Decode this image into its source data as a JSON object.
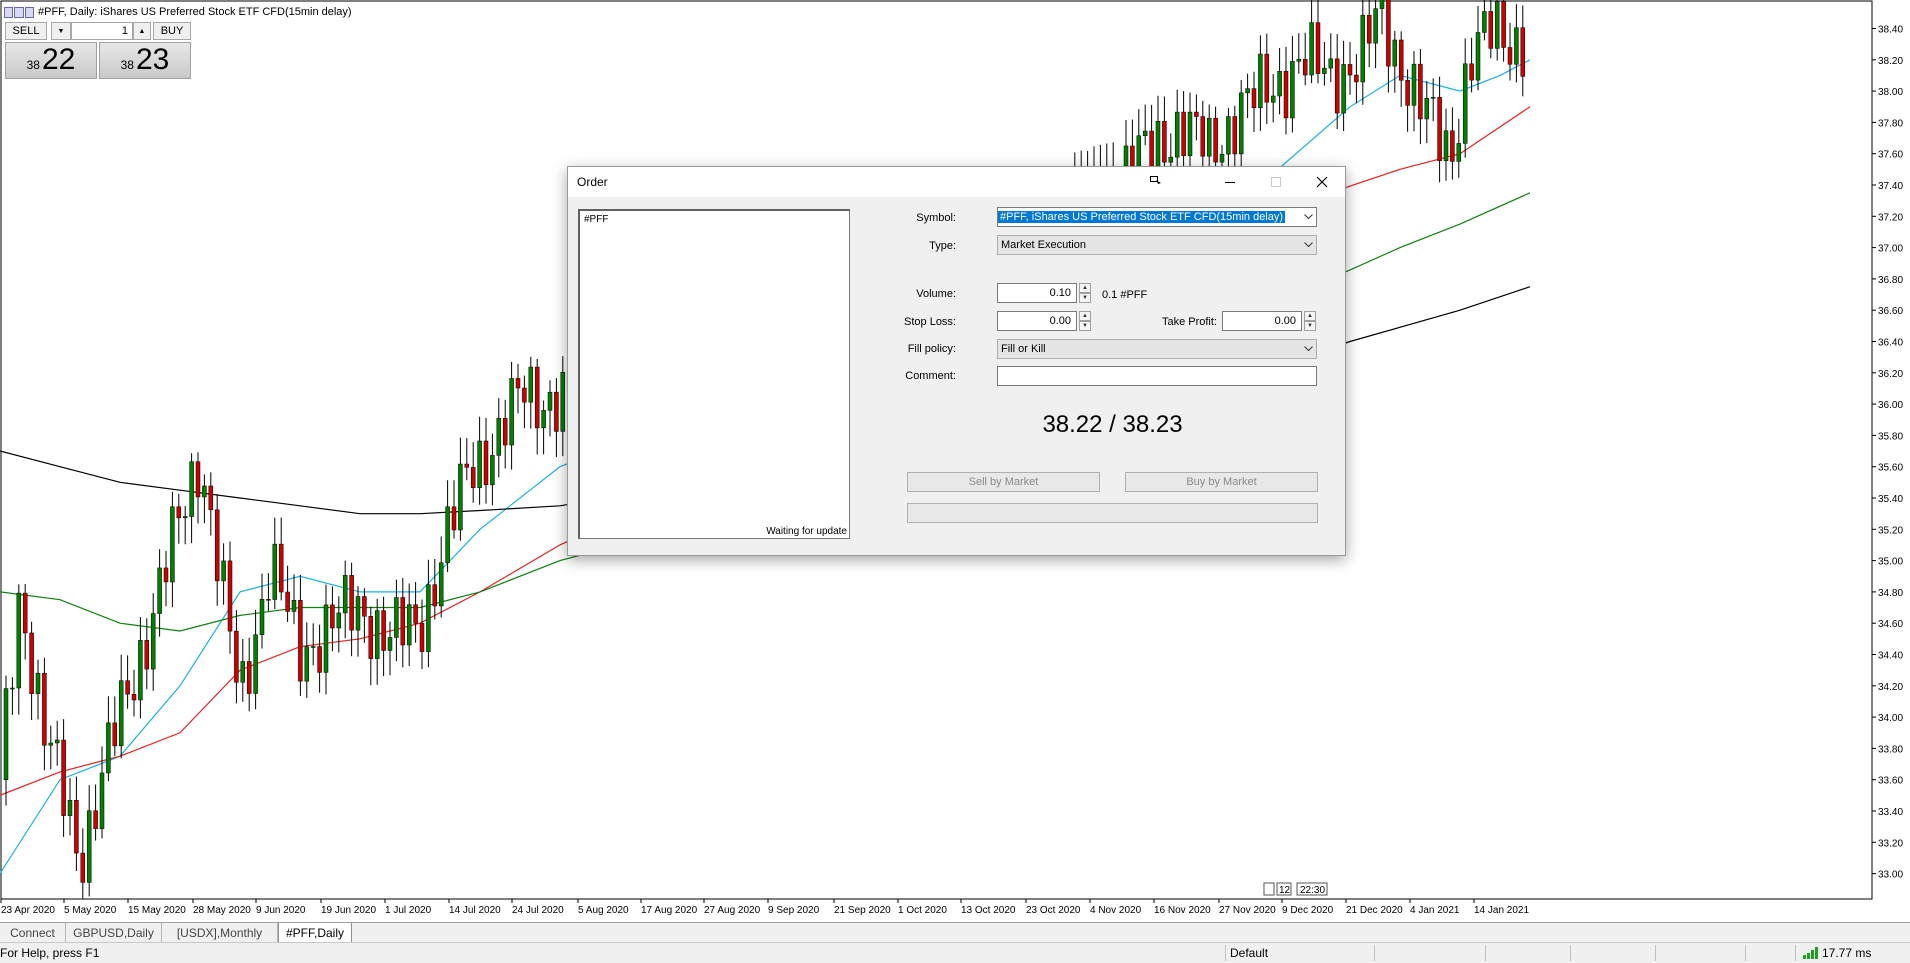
{
  "chart": {
    "title": "#PFF, Daily:  iShares US Preferred Stock ETF CFD(15min delay)",
    "price_labels": [
      "38.40",
      "38.20",
      "38.00",
      "37.80",
      "37.60",
      "37.40",
      "37.20",
      "37.00",
      "36.80",
      "36.60",
      "36.40",
      "36.20",
      "36.00",
      "35.80",
      "35.60",
      "35.40",
      "35.20",
      "35.00",
      "34.80",
      "34.60",
      "34.40",
      "34.20",
      "34.00",
      "33.80",
      "33.60",
      "33.40",
      "33.20",
      "33.00"
    ],
    "date_labels": [
      "23 Apr 2020",
      "5 May 2020",
      "15 May 2020",
      "28 May 2020",
      "9 Jun 2020",
      "19 Jun 2020",
      "1 Jul 2020",
      "14 Jul 2020",
      "24 Jul 2020",
      "5 Aug 2020",
      "17 Aug 2020",
      "27 Aug 2020",
      "9 Sep 2020",
      "21 Sep 2020",
      "1 Oct 2020",
      "13 Oct 2020",
      "23 Oct 2020",
      "4 Nov 2020",
      "16 Nov 2020",
      "27 Nov 2020",
      "9 Dec 2020",
      "21 Dec 2020",
      "4 Jan 2021",
      "14 Jan 2021"
    ],
    "time_box": "22:30",
    "time_box_small": "12",
    "colors": {
      "up": "#008000",
      "down": "#cc0000",
      "ma_fast": "#1ab0e8",
      "ma_mid": "#e82020",
      "ma_slow": "#108010",
      "ma_long": "#000000"
    }
  },
  "oneclick": {
    "sell_label": "SELL",
    "buy_label": "BUY",
    "volume": "1",
    "sell_small": "38",
    "sell_big": "22",
    "buy_small": "38",
    "buy_big": "23"
  },
  "tabs": [
    "Connect",
    "GBPUSD,Daily",
    "[USDX],Monthly",
    "#PFF,Daily"
  ],
  "active_tab": "#PFF,Daily",
  "status": {
    "help": "For Help, press F1",
    "profile": "Default",
    "ping": "17.77 ms"
  },
  "order": {
    "title": "Order",
    "tick_symbol": "#PFF",
    "waiting": "Waiting for update",
    "symbol_label": "Symbol:",
    "symbol_value": "#PFF, iShares US Preferred Stock ETF CFD(15min delay)",
    "type_label": "Type:",
    "type_value": "Market Execution",
    "volume_label": "Volume:",
    "volume_value": "0.10",
    "volume_hint": "0.1 #PFF",
    "sl_label": "Stop Loss:",
    "sl_value": "0.00",
    "tp_label": "Take Profit:",
    "tp_value": "0.00",
    "fill_label": "Fill policy:",
    "fill_value": "Fill or Kill",
    "comment_label": "Comment:",
    "comment_value": "",
    "quote": "38.22 / 38.23",
    "sell_btn": "Sell by Market",
    "buy_btn": "Buy by Market"
  }
}
